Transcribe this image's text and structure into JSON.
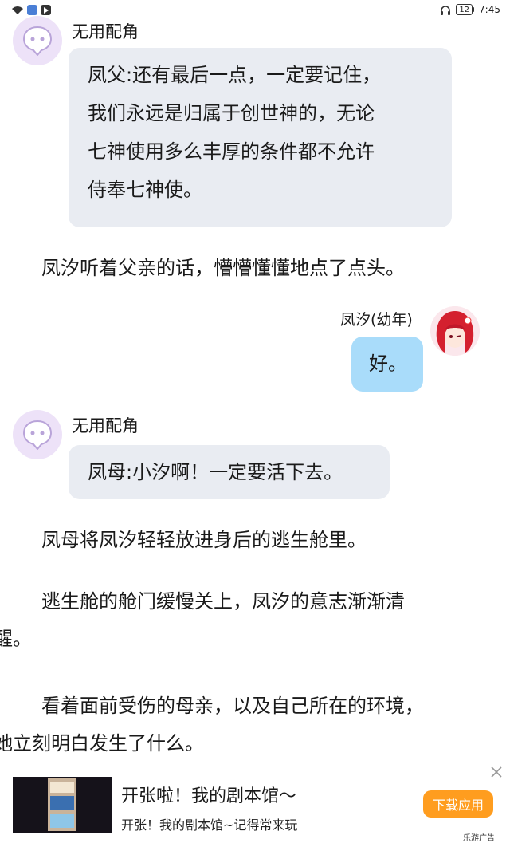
{
  "status_bar": {
    "battery": "12",
    "time": "7:45",
    "left_icons": [
      "wifi-icon",
      "message-app-icon",
      "media-app-icon"
    ],
    "right_icons": [
      "headphones-icon",
      "battery-icon"
    ]
  },
  "messages": [
    {
      "speaker": "无用配角",
      "lines": [
        "凤父:还有最后一点，一定要记住，",
        "我们永远是归属于创世神的，无论",
        "七神使用多么丰厚的条件都不允许",
        "侍奉七神使。"
      ]
    },
    {
      "narration": "凤汐听着父亲的话，懵懵懂懂地点了点头。"
    },
    {
      "speaker": "凤汐(幼年)",
      "text": "好。"
    },
    {
      "speaker": "无用配角",
      "text": "凤母:小汐啊！一定要活下去。"
    },
    {
      "narration": "凤母将凤汐轻轻放进身后的逃生舱里。"
    },
    {
      "narration_lines": [
        "逃生舱的舱门缓慢关上，凤汐的意志渐渐清",
        "醒。"
      ]
    },
    {
      "narration_lines": [
        "看着面前受伤的母亲，以及自己所在的环境，",
        "她立刻明白发生了什么。"
      ]
    }
  ],
  "ad": {
    "title": "开张啦！我的剧本馆～",
    "subtitle": "开张！我的剧本馆~记得常来玩",
    "button": "下载应用",
    "source": "乐游广告"
  },
  "colors": {
    "bubble_grey": "#e9ecf2",
    "bubble_blue": "#a9dcfa",
    "avatar_bg": "#ede2f8",
    "ad_button": "#ff9d1f"
  }
}
